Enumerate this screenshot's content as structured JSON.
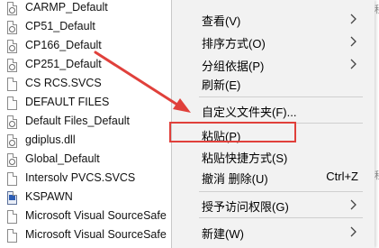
{
  "files": [
    {
      "name": "CARMP_Default",
      "icon": "config-file-icon"
    },
    {
      "name": "CP51_Default",
      "icon": "config-file-icon"
    },
    {
      "name": "CP166_Default",
      "icon": "config-file-icon"
    },
    {
      "name": "CP251_Default",
      "icon": "config-file-icon"
    },
    {
      "name": "CS RCS.SVCS",
      "icon": "file-icon"
    },
    {
      "name": "DEFAULT FILES",
      "icon": "file-icon"
    },
    {
      "name": "Default Files_Default",
      "icon": "config-file-icon"
    },
    {
      "name": "gdiplus.dll",
      "icon": "config-file-icon"
    },
    {
      "name": "Global_Default",
      "icon": "config-file-icon"
    },
    {
      "name": "Intersolv PVCS.SVCS",
      "icon": "file-icon"
    },
    {
      "name": "KSPAWN",
      "icon": "application-icon"
    },
    {
      "name": "Microsoft Visual SourceSafe",
      "icon": "file-icon"
    },
    {
      "name": "Microsoft Visual SourceSafe",
      "icon": "file-icon"
    }
  ],
  "right_edge": [
    "迎程",
    "S",
    "S",
    "S",
    "S",
    "迎程",
    "S",
    "S",
    "S",
    "S"
  ],
  "menu": {
    "view": "查看(V)",
    "sort": "排序方式(O)",
    "group": "分组依据(P)",
    "refresh": "刷新(E)",
    "customize": "自定义文件夹(F)...",
    "paste": "粘贴(P)",
    "paste_shortcut": "粘贴快捷方式(S)",
    "undo_delete": "撤消 删除(U)",
    "undo_shortcut": "Ctrl+Z",
    "give_access": "授予访问权限(G)",
    "new": "新建(W)"
  },
  "colors": {
    "annotation_red": "#e0403b",
    "menu_background": "#f2f2f2"
  }
}
